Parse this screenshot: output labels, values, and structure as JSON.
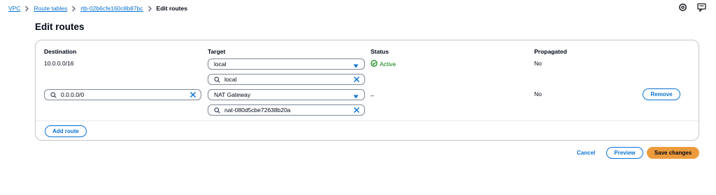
{
  "breadcrumb": {
    "items": [
      {
        "label": "VPC"
      },
      {
        "label": "Route tables"
      },
      {
        "label": "rtb-02b6cfe160c8b87bc"
      }
    ],
    "current": "Edit routes"
  },
  "icons": {
    "top_right": [
      "settings-gear-icon",
      "feedback-icon"
    ],
    "search": "search-icon",
    "clear": "close-icon",
    "caret": "caret-down-icon",
    "status_ok": "status-success-icon"
  },
  "page": {
    "title": "Edit routes"
  },
  "table": {
    "headers": {
      "destination": "Destination",
      "target": "Target",
      "status": "Status",
      "propagated": "Propagated"
    },
    "rows": [
      {
        "destination": "10.0.0.0/16",
        "target_type": "local",
        "target_value": "local",
        "status": "Active",
        "propagated": "No"
      },
      {
        "destination": "0.0.0.0/0",
        "target_type": "NAT Gateway",
        "target_value": "nat-080d5cbe72638b20a",
        "status": "–",
        "propagated": "No",
        "remove_label": "Remove"
      }
    ]
  },
  "actions": {
    "add_route": "Add route",
    "cancel": "Cancel",
    "preview": "Preview",
    "save": "Save changes"
  },
  "colors": {
    "link": "#0972d3",
    "success": "#037f0c",
    "primary": "#ec9b3c",
    "border": "#7d8998",
    "text": "#000716"
  }
}
